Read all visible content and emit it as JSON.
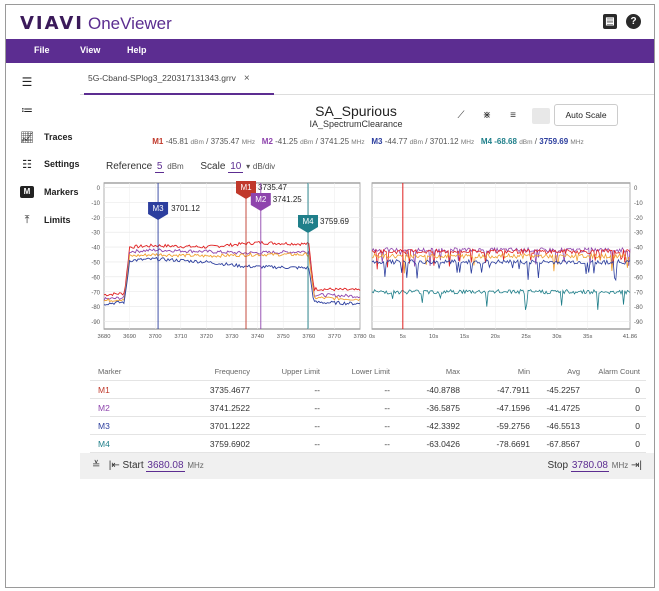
{
  "app": {
    "logo": "VIAVI",
    "name": "OneViewer"
  },
  "menu": [
    "File",
    "View",
    "Help"
  ],
  "sidebar": {
    "items": [
      {
        "label": "",
        "icon": "hamburger-icon"
      },
      {
        "label": "",
        "icon": "list-icon"
      },
      {
        "label": "Traces",
        "icon": "chart-icon"
      },
      {
        "label": "Settings",
        "icon": "sliders-icon"
      },
      {
        "label": "Markers",
        "icon": "marker-icon"
      },
      {
        "label": "Limits",
        "icon": "limits-icon"
      }
    ]
  },
  "tab": {
    "label": "5G-Cband-SPlog3_220317131343.grrv",
    "close": "×"
  },
  "plot_header": {
    "title": "SA_Spurious",
    "subtitle": "IA_SpectrumClearance",
    "auto_scale": "Auto Scale"
  },
  "markers": [
    {
      "name": "M1",
      "dbm": "-45.81",
      "freq": "3735.47",
      "color": "#c0392b"
    },
    {
      "name": "M2",
      "dbm": "-41.25",
      "freq": "3741.25",
      "color": "#8e44ad"
    },
    {
      "name": "M3",
      "dbm": "-44.77",
      "freq": "3701.12",
      "color": "#2c3e9e"
    },
    {
      "name": "M4",
      "dbm": "-68.68",
      "freq": "3759.69",
      "color": "#1f7f8a"
    }
  ],
  "units": {
    "dbm": "dBm",
    "mhz": "MHz",
    "slash": "/",
    "dbdiv": "dB/div"
  },
  "reference": {
    "label": "Reference",
    "value": "5",
    "unit": "dBm"
  },
  "scale": {
    "label": "Scale",
    "value": "10",
    "unit": "dB/div"
  },
  "chart_data": [
    {
      "type": "line",
      "xlabel": "",
      "ylabel": "",
      "x_ticks": [
        "3680",
        "3690",
        "3700",
        "3710",
        "3720",
        "3730",
        "3740",
        "3750",
        "3760",
        "3770",
        "3780"
      ],
      "y_ticks": [
        "0",
        "-10",
        "-20",
        "-30",
        "-40",
        "-50",
        "-60",
        "-70",
        "-80",
        "-90"
      ],
      "xlim": [
        3680,
        3780
      ],
      "ylim": [
        -95,
        3
      ],
      "series": [
        {
          "color": "#e02020",
          "x": [
            3680,
            3688,
            3690,
            3700,
            3720,
            3740,
            3760,
            3762,
            3780
          ],
          "values": [
            -72,
            -71,
            -40,
            -39,
            -40,
            -37,
            -38,
            -68,
            -69
          ]
        },
        {
          "color": "#8e44ad",
          "x": [
            3680,
            3688,
            3690,
            3700,
            3720,
            3735,
            3760,
            3762,
            3780
          ],
          "values": [
            -75,
            -74,
            -43,
            -42,
            -43,
            -44,
            -43,
            -72,
            -73
          ]
        },
        {
          "color": "#f0a030",
          "x": [
            3680,
            3688,
            3690,
            3700,
            3720,
            3740,
            3760,
            3762,
            3780
          ],
          "values": [
            -76,
            -75,
            -46,
            -45,
            -46,
            -45,
            -45,
            -74,
            -75
          ]
        },
        {
          "color": "#2c3e9e",
          "x": [
            3680,
            3688,
            3690,
            3700,
            3720,
            3735,
            3760,
            3762,
            3780
          ],
          "values": [
            -78,
            -77,
            -49,
            -48,
            -50,
            -53,
            -54,
            -77,
            -78
          ]
        }
      ],
      "marker_labels": [
        "M1",
        "M2",
        "M3",
        "M4"
      ],
      "marker_values": [
        "3735.47",
        "3741.25",
        "3701.12",
        "3759.69"
      ]
    },
    {
      "type": "line",
      "xlabel": "",
      "ylabel": "",
      "x_ticks": [
        "0s",
        "5s",
        "10s",
        "15s",
        "20s",
        "25s",
        "30s",
        "35s",
        "41.86"
      ],
      "y_ticks": [
        "0",
        "-10",
        "-20",
        "-30",
        "-40",
        "-50",
        "-60",
        "-70",
        "-80",
        "-90"
      ],
      "xlim": [
        0,
        41.86
      ],
      "ylim": [
        -95,
        3
      ],
      "marker_time": 5,
      "series": [
        {
          "color": "#8e44ad",
          "level": -42
        },
        {
          "color": "#e02020",
          "level": -43
        },
        {
          "color": "#f0a030",
          "level": -46
        },
        {
          "color": "#2c3e9e",
          "level": -50
        },
        {
          "color": "#1f7f8a",
          "level": -70
        }
      ]
    }
  ],
  "table": {
    "headers": [
      "Marker",
      "Frequency",
      "Upper Limit",
      "Lower Limit",
      "Max",
      "Min",
      "Avg",
      "Alarm Count"
    ],
    "rows": [
      {
        "marker": "M1",
        "frequency": "3735.4677",
        "upper": "--",
        "lower": "--",
        "max": "-40.8788",
        "min": "-47.7911",
        "avg": "-45.2257",
        "alarm": "0"
      },
      {
        "marker": "M2",
        "frequency": "3741.2522",
        "upper": "--",
        "lower": "--",
        "max": "-36.5875",
        "min": "-47.1596",
        "avg": "-41.4725",
        "alarm": "0"
      },
      {
        "marker": "M3",
        "frequency": "3701.1222",
        "upper": "--",
        "lower": "--",
        "max": "-42.3392",
        "min": "-59.2756",
        "avg": "-46.5513",
        "alarm": "0"
      },
      {
        "marker": "M4",
        "frequency": "3759.6902",
        "upper": "--",
        "lower": "--",
        "max": "-63.0426",
        "min": "-78.6691",
        "avg": "-67.8567",
        "alarm": "0"
      }
    ]
  },
  "footer": {
    "start_label": "Start",
    "start_value": "3680.08",
    "stop_label": "Stop",
    "stop_value": "3780.08",
    "unit": "MHz"
  }
}
